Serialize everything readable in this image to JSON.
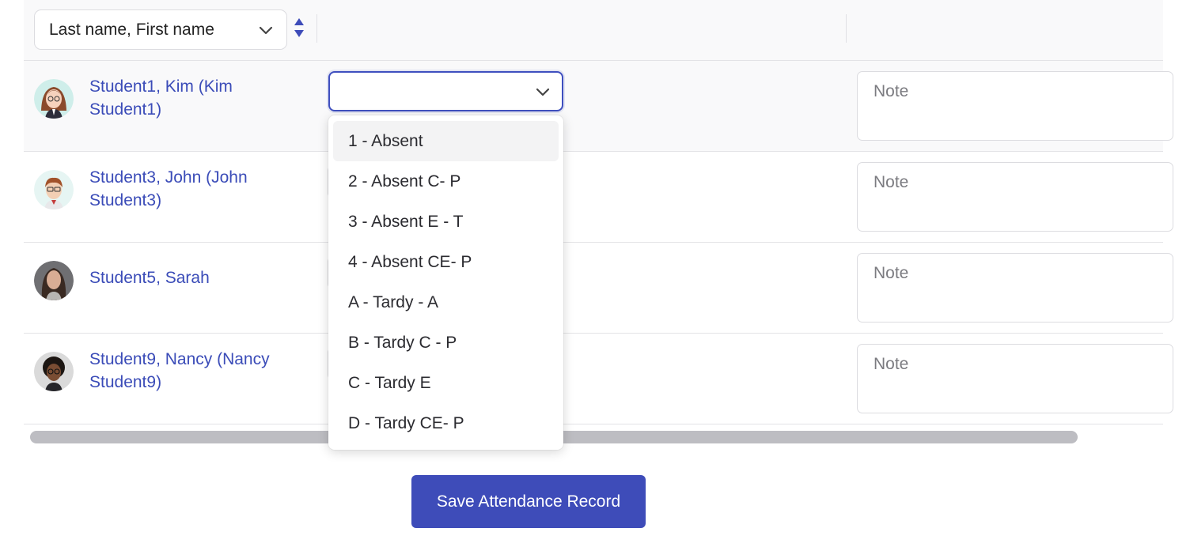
{
  "sort": {
    "selected": "Last name, First name"
  },
  "students": [
    {
      "name_line1": "Student1, Kim (Kim",
      "name_line2": "Student1)",
      "note_placeholder": "Note",
      "avatar": "avatar-kim"
    },
    {
      "name_line1": "Student3, John (John",
      "name_line2": "Student3)",
      "note_placeholder": "Note",
      "avatar": "avatar-john"
    },
    {
      "name_line1": "Student5, Sarah",
      "name_line2": "",
      "note_placeholder": "Note",
      "avatar": "avatar-sarah"
    },
    {
      "name_line1": "Student9, Nancy (Nancy",
      "name_line2": "Student9)",
      "note_placeholder": "Note",
      "avatar": "avatar-nancy"
    }
  ],
  "attendance_dropdown": {
    "selected": "",
    "options": [
      "1 - Absent",
      "2 - Absent C- P",
      "3 - Absent E - T",
      "4 - Absent CE- P",
      "A - Tardy - A",
      "B - Tardy C - P",
      "C - Tardy E",
      "D - Tardy CE- P"
    ],
    "highlighted_index": 0
  },
  "save_button": {
    "label": "Save Attendance Record"
  },
  "colors": {
    "accent": "#3e4cb9",
    "link": "#3b4cb8",
    "header_bg": "#f9f9fa",
    "scrollbar": "#bdbdc2"
  },
  "icons": [
    "chevron-down-icon",
    "sort-arrows-icon"
  ]
}
